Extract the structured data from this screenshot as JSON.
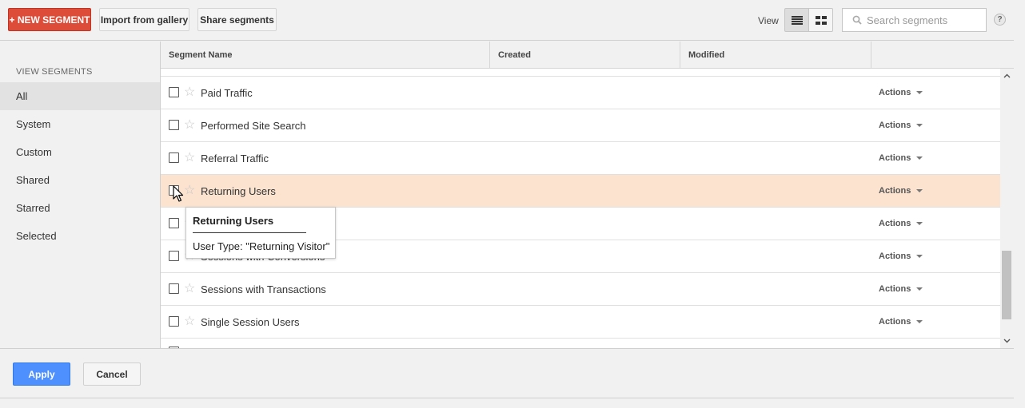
{
  "toolbar": {
    "new_segment_label": "+ NEW SEGMENT",
    "import_label": "Import from gallery",
    "share_label": "Share segments",
    "view_label": "View",
    "search_placeholder": "Search segments",
    "help_label": "?"
  },
  "sidebar": {
    "heading": "VIEW SEGMENTS",
    "items": [
      {
        "label": "All",
        "active": true
      },
      {
        "label": "System"
      },
      {
        "label": "Custom"
      },
      {
        "label": "Shared"
      },
      {
        "label": "Starred"
      },
      {
        "label": "Selected"
      }
    ]
  },
  "table": {
    "columns": [
      "Segment Name",
      "Created",
      "Modified"
    ],
    "rows": [
      {
        "name": "Paid Traffic",
        "actions": "Actions"
      },
      {
        "name": "Performed Site Search",
        "actions": "Actions"
      },
      {
        "name": "Referral Traffic",
        "actions": "Actions"
      },
      {
        "name": "Returning Users",
        "actions": "Actions",
        "highlighted": true
      },
      {
        "name": "",
        "actions": "Actions"
      },
      {
        "name": "Sessions with Conversions",
        "actions": "Actions"
      },
      {
        "name": "Sessions with Transactions",
        "actions": "Actions"
      },
      {
        "name": "Single Session Users",
        "actions": "Actions"
      }
    ]
  },
  "tooltip": {
    "title": "Returning Users",
    "description": "User Type: \"Returning Visitor\""
  },
  "footer": {
    "apply_label": "Apply",
    "cancel_label": "Cancel"
  },
  "colors": {
    "new_segment_red": "#dd4b39",
    "apply_blue": "#4d90fe",
    "highlight_row": "#fbe3cf"
  },
  "icons": [
    "search-icon",
    "list-view-icon",
    "grid-view-icon",
    "help-icon",
    "star-icon",
    "caret-down-icon",
    "mouse-cursor-icon"
  ]
}
